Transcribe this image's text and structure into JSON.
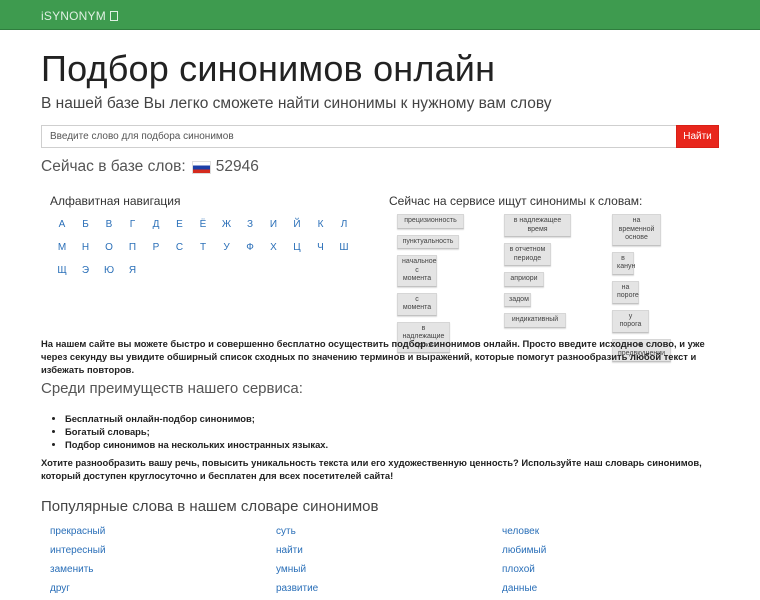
{
  "navbar": {
    "brand": "iSYNONYM"
  },
  "hero": {
    "title": "Подбор синонимов онлайн",
    "subtitle": "В нашей базе Вы легко сможете найти синонимы к нужному вам слову"
  },
  "search": {
    "placeholder": "Введите слово для подбора синонимов",
    "button": "Найти"
  },
  "db_count": {
    "label": "Сейчас в базе слов:",
    "value": "52946"
  },
  "alphabet": {
    "title": "Алфавитная навигация",
    "rows": [
      [
        "А",
        "Б",
        "В",
        "Г",
        "Д",
        "Е",
        "Ё",
        "Ж",
        "З",
        "И",
        "Й",
        "К",
        "Л"
      ],
      [
        "М",
        "Н",
        "О",
        "П",
        "Р",
        "С",
        "Т",
        "У",
        "Ф",
        "Х",
        "Ц",
        "Ч",
        "Ш"
      ],
      [
        "Щ",
        "Э",
        "Ю",
        "Я"
      ]
    ]
  },
  "recent_searches": {
    "title": "Сейчас на сервисе ищут синонимы к словам:",
    "columns": [
      [
        "прецизионность",
        "пунктуальность",
        "начальное с момента",
        "с момента",
        "в надлежащие сроки"
      ],
      [
        "в надлежащее время",
        "в отчетном периоде",
        "априори",
        "задом",
        "индикативный"
      ],
      [
        "на временной основе",
        "в канун",
        "на пороге",
        "у порога",
        "в предвкушении"
      ]
    ]
  },
  "intro_text": "На нашем сайте вы можете быстро и совершенно бесплатно осуществить подбор синонимов онлайн. Просто введите исходное слово, и уже через секунду вы увидите обширный список сходных по значению терминов и выражений, которые помогут разнообразить любой текст и избежать повторов.",
  "benefits": {
    "title": "Среди преимуществ нашего сервиса:",
    "items": [
      "Бесплатный онлайн-подбор синонимов;",
      "Богатый словарь;",
      "Подбор синонимов на нескольких иностранных языках."
    ]
  },
  "outro_text": "Хотите разнообразить вашу речь, повысить уникальность текста или его художественную ценность? Используйте наш словарь синонимов, который доступен круглосуточно и бесплатен для всех посетителей сайта!",
  "popular": {
    "title": "Популярные слова в нашем словаре синонимов",
    "columns": [
      [
        "прекрасный",
        "интересный",
        "заменить",
        "друг"
      ],
      [
        "суть",
        "найти",
        "умный",
        "развитие"
      ],
      [
        "человек",
        "любимый",
        "плохой",
        "данные"
      ]
    ]
  }
}
